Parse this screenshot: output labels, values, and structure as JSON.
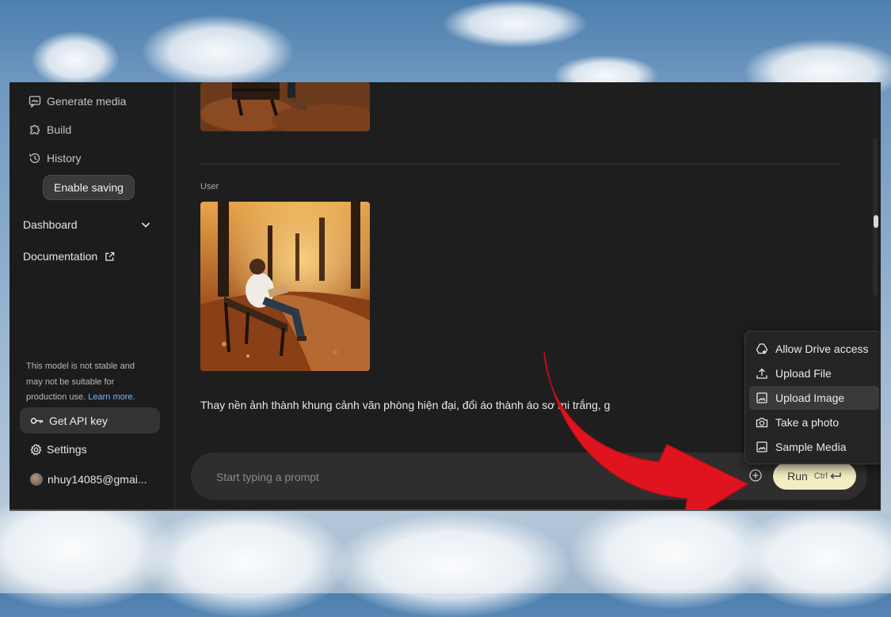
{
  "sidebar": {
    "nav": [
      {
        "label": "Generate media",
        "icon": "image-chat-icon"
      },
      {
        "label": "Build",
        "icon": "puzzle-icon"
      },
      {
        "label": "History",
        "icon": "history-icon"
      }
    ],
    "enable_saving": "Enable saving",
    "dashboard": "Dashboard",
    "documentation": "Documentation",
    "notice": "This model is not stable and may not be suitable for production use.",
    "notice_link": "Learn more.",
    "api_key": "Get API key",
    "settings": "Settings",
    "account": "nhuy14085@gmai..."
  },
  "chat": {
    "user_label": "User",
    "message": "Thay nền ảnh thành khung cảnh văn phòng hiện đại, đổi áo thành áo sơ mi trắng, g"
  },
  "input": {
    "placeholder": "Start typing a prompt",
    "run_label": "Run",
    "run_shortcut": "Ctrl"
  },
  "menu": {
    "items": [
      {
        "label": "Allow Drive access",
        "icon": "drive-add-icon"
      },
      {
        "label": "Upload File",
        "icon": "upload-icon"
      },
      {
        "label": "Upload Image",
        "icon": "image-icon",
        "highlighted": true
      },
      {
        "label": "Take a photo",
        "icon": "camera-icon"
      },
      {
        "label": "Sample Media",
        "icon": "image-icon"
      }
    ]
  },
  "colors": {
    "arrow": "#e0141f",
    "run_button": "#f2eec2",
    "link": "#7fb0ff"
  }
}
